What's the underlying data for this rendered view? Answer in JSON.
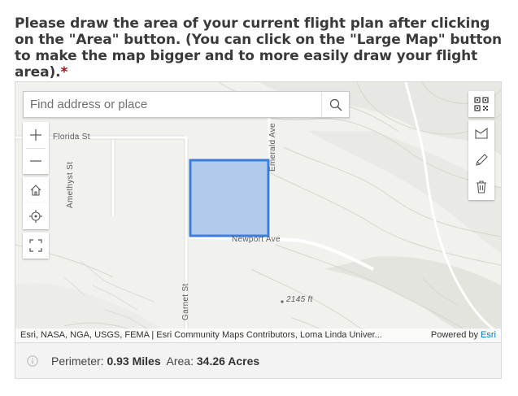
{
  "question": {
    "text": "Please draw the area of your current flight plan after clicking on the \"Area\" button. (You can click on the \"Large Map\" button to make the map bigger and to more easily draw your flight area).",
    "required_mark": "*"
  },
  "map": {
    "search_placeholder": "Find address or place",
    "labels": {
      "florida": "Florida St",
      "amethyst": "Amethyst St",
      "emerald": "Emerald Ave",
      "newport": "Newport Ave",
      "garnet": "Garnet St",
      "elevation": "2145 ft"
    },
    "attribution": "Esri, NASA, NGA, USGS, FEMA | Esri Community Maps Contributors, Loma Linda Univer...",
    "powered_by": "Powered by ",
    "powered_link": "Esri",
    "polygon_color": "#3b7ddd",
    "polygon_fill": "#a8c4ea"
  },
  "footer": {
    "perimeter_label": "Perimeter:",
    "perimeter_value": "0.93 Miles",
    "area_label": "Area:",
    "area_value": "34.26 Acres"
  }
}
